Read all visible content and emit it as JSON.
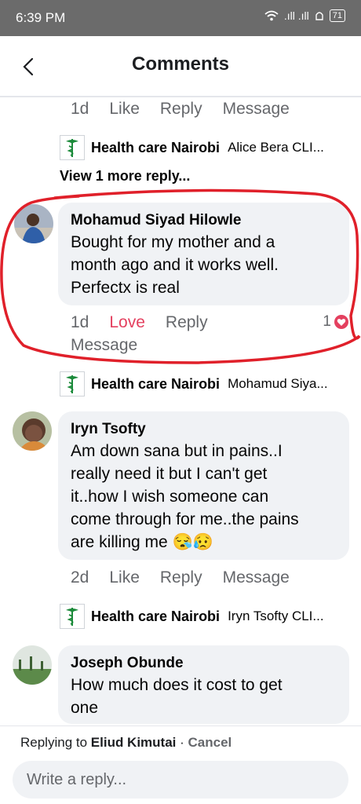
{
  "status_bar": {
    "time": "6:39 PM",
    "signal_text": ".ıll .ıll",
    "battery": "71"
  },
  "header": {
    "title": "Comments"
  },
  "top_actions": {
    "time": "1d",
    "like": "Like",
    "reply": "Reply",
    "message": "Message"
  },
  "reply1": {
    "page_name": "Health care Nairobi",
    "snippet": "Alice Bera CLI..."
  },
  "view_more": "View 1 more reply...",
  "comment1": {
    "author": "Mohamud Siyad Hilowle",
    "line1": "Bought for my mother and a",
    "line2": "month ago and it works well.",
    "line3": "Perfectx is real",
    "time": "1d",
    "love": "Love",
    "reply": "Reply",
    "reaction_count": "1",
    "message": "Message"
  },
  "reply2": {
    "page_name": "Health care Nairobi",
    "snippet": "Mohamud Siya..."
  },
  "comment2": {
    "author": "Iryn Tsofty",
    "line1": "Am down sana but in pains..I",
    "line2": "really need it but I can't get",
    "line3": "it..how I wish someone can",
    "line4": "come through for me..the pains",
    "line5": "are killing me 😪😥",
    "time": "2d",
    "like": "Like",
    "reply": "Reply",
    "message": "Message"
  },
  "reply3": {
    "page_name": "Health care Nairobi",
    "snippet": "Iryn Tsofty CLI..."
  },
  "comment3": {
    "author": "Joseph Obunde",
    "line1": "How much does it cost to get",
    "line2": "one"
  },
  "footer": {
    "replying_prefix": "Replying to ",
    "replying_name": "Eliud Kimutai",
    "separator": " · ",
    "cancel": "Cancel",
    "input_placeholder": "Write a reply..."
  },
  "colors": {
    "highlight": "#e0202a",
    "love": "#e4405f",
    "brand_green": "#1b8a3a"
  }
}
